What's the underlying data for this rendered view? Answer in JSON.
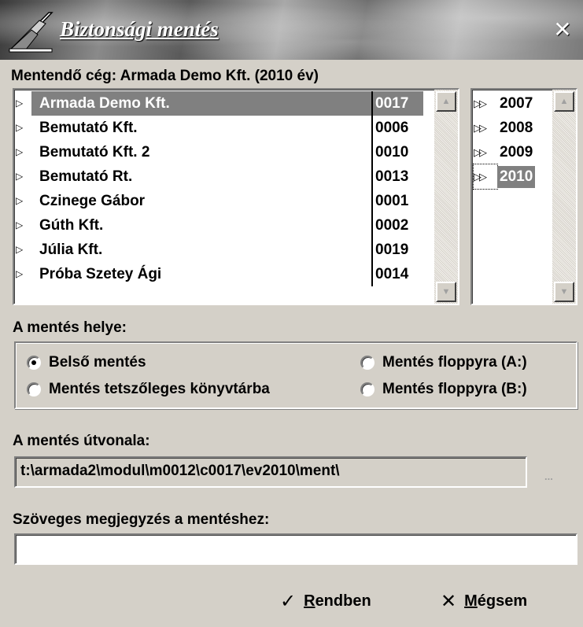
{
  "window": {
    "title": "Biztonsági mentés",
    "close_glyph": "✕"
  },
  "company_label": "Mentendő cég: Armada Demo Kft. (2010 év)",
  "companies": [
    {
      "name": "Armada Demo Kft.",
      "code": "0017",
      "selected": true
    },
    {
      "name": "Bemutató Kft.",
      "code": "0006",
      "selected": false
    },
    {
      "name": "Bemutató Kft. 2",
      "code": "0010",
      "selected": false
    },
    {
      "name": "Bemutató Rt.",
      "code": "0013",
      "selected": false
    },
    {
      "name": "Czinege Gábor",
      "code": "0001",
      "selected": false
    },
    {
      "name": "Gúth Kft.",
      "code": "0002",
      "selected": false
    },
    {
      "name": "Júlia Kft.",
      "code": "0019",
      "selected": false
    },
    {
      "name": "Próba Szetey Ági",
      "code": "0014",
      "selected": false
    }
  ],
  "years": [
    {
      "year": "2007",
      "selected": false
    },
    {
      "year": "2008",
      "selected": false
    },
    {
      "year": "2009",
      "selected": false
    },
    {
      "year": "2010",
      "selected": true
    }
  ],
  "location": {
    "label": "A mentés helye:",
    "options": [
      {
        "label": "Belső mentés",
        "checked": true
      },
      {
        "label": "Mentés floppyra (A:)",
        "checked": false
      },
      {
        "label": "Mentés tetszőleges könyvtárba",
        "checked": false
      },
      {
        "label": "Mentés floppyra (B:)",
        "checked": false
      }
    ]
  },
  "path": {
    "label": "A mentés útvonala:",
    "value": "t:\\armada2\\modul\\m0012\\c0017\\ev2010\\ment\\",
    "browse": "..."
  },
  "note": {
    "label": "Szöveges megjegyzés a mentéshez:",
    "value": ""
  },
  "buttons": {
    "ok_icon": "✓",
    "ok_accel": "R",
    "ok_rest": "endben",
    "cancel_icon": "✕",
    "cancel_accel": "M",
    "cancel_rest": "égsem"
  },
  "icons": {
    "row_marker": "triangle-right-icon",
    "year_marker": "double-triangle-right-icon",
    "logo": "app-logo"
  }
}
